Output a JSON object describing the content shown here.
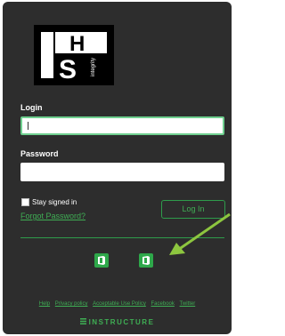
{
  "logo": {
    "letters": "IHS",
    "sub": "Integrity"
  },
  "login": {
    "label": "Login",
    "value": ""
  },
  "password": {
    "label": "Password",
    "value": ""
  },
  "stay_signed_in": {
    "label": "Stay signed in",
    "checked": false
  },
  "forgot_password": "Forgot Password?",
  "login_button": "Log In",
  "footer": {
    "links": [
      "Help",
      "Privacy policy",
      "Acceptable Use Policy",
      "Facebook",
      "Twitter"
    ]
  },
  "brand": "INSTRUCTURE",
  "colors": {
    "accent": "#3fae54",
    "panel": "#2d2d2d",
    "arrow": "#8dc63f"
  },
  "icons": [
    "office-sso-icon",
    "office-sso-icon",
    "instructure-icon"
  ]
}
